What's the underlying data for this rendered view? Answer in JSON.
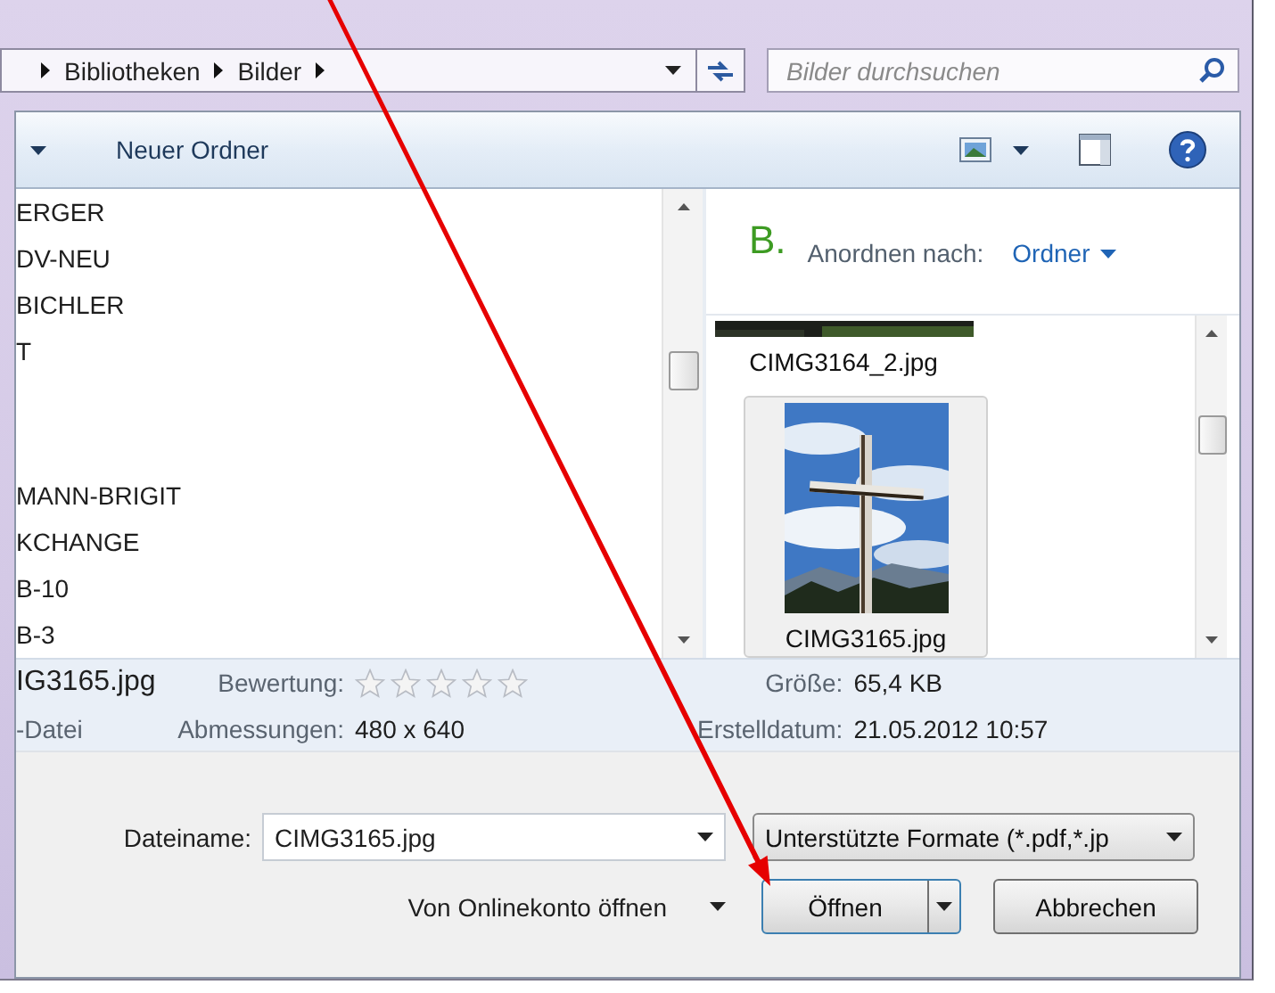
{
  "address_bar": {
    "crumbs": [
      "Bibliotheken",
      "Bilder"
    ]
  },
  "search": {
    "placeholder": "Bilder durchsuchen"
  },
  "toolbar": {
    "new_folder": "Neuer Ordner"
  },
  "folder_list": {
    "items": [
      {
        "label": "ERGER",
        "spaced": false
      },
      {
        "label": "DV-NEU",
        "spaced": false
      },
      {
        "label": "BICHLER",
        "spaced": false
      },
      {
        "label": "T",
        "spaced": false
      },
      {
        "label": "MANN-BRIGIT",
        "spaced": true
      },
      {
        "label": "KCHANGE",
        "spaced": false
      },
      {
        "label": "B-10",
        "spaced": false
      },
      {
        "label": "B-3",
        "spaced": false
      }
    ]
  },
  "preview_pane": {
    "library_initial": "B.",
    "arrange_label": "Anordnen nach:",
    "arrange_value": "Ordner",
    "files": [
      {
        "name": "CIMG3164_2.jpg",
        "kind": "partial",
        "selected": false
      },
      {
        "name": "CIMG3165.jpg",
        "kind": "picture",
        "selected": true
      }
    ]
  },
  "details": {
    "name": "IG3165.jpg",
    "type": "-Datei",
    "fields": [
      {
        "label": "Bewertung:",
        "kind": "stars",
        "stars": 0
      },
      {
        "label": "Größe:",
        "kind": "text",
        "value": "65,4 KB"
      },
      {
        "label": "Abmessungen:",
        "kind": "text",
        "value": "480 x 640"
      },
      {
        "label": "Erstelldatum:",
        "kind": "text",
        "value": "21.05.2012 10:57"
      }
    ]
  },
  "file_name": {
    "label": "Dateiname:",
    "value": "CIMG3165.jpg"
  },
  "file_type": {
    "value": "Unterstützte Formate (*.pdf,*.jp"
  },
  "online_open": "Von Onlinekonto öffnen",
  "buttons": [
    {
      "label": "Öffnen",
      "kind": "split"
    },
    {
      "label": "Abbrechen",
      "kind": "plain"
    }
  ]
}
